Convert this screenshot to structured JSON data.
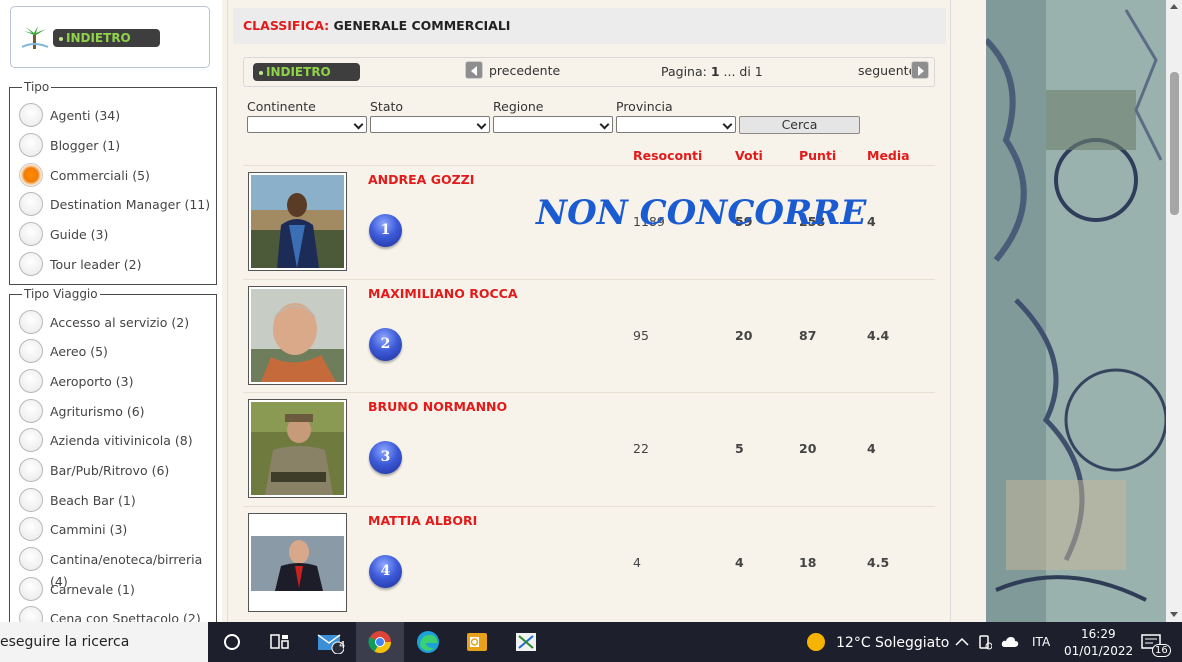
{
  "sidebar": {
    "back_button": "INDIETRO",
    "tipo": {
      "legend": "Tipo",
      "items": [
        {
          "label": "Agenti (34)",
          "checked": false
        },
        {
          "label": "Blogger (1)",
          "checked": false
        },
        {
          "label": "Commerciali (5)",
          "checked": true
        },
        {
          "label": "Destination Manager (11)",
          "checked": false
        },
        {
          "label": "Guide (3)",
          "checked": false
        },
        {
          "label": "Tour leader (2)",
          "checked": false
        }
      ]
    },
    "tipo_viaggio": {
      "legend": "Tipo Viaggio",
      "items": [
        {
          "label": "Accesso al servizio (2)"
        },
        {
          "label": "Aereo (5)"
        },
        {
          "label": "Aeroporto (3)"
        },
        {
          "label": "Agriturismo (6)"
        },
        {
          "label": "Azienda vitivinicola (8)"
        },
        {
          "label": "Bar/Pub/Ritrovo (6)"
        },
        {
          "label": "Beach Bar (1)"
        },
        {
          "label": "Cammini (3)"
        },
        {
          "label": "Cantina/enoteca/birreria"
        },
        {
          "label": "(4)"
        },
        {
          "label": "Carnevale (1)"
        },
        {
          "label": "Cena con Spettacolo (2)"
        }
      ]
    }
  },
  "main": {
    "title_prefix": "CLASSIFICA:",
    "title": "GENERALE COMMERCIALI",
    "nav": {
      "back": "INDIETRO",
      "prev": "precedente",
      "page_prefix": "Pagina:",
      "page_current": "1",
      "page_suffix": "... di 1",
      "next": "seguente"
    },
    "filters": {
      "continente": "Continente",
      "stato": "Stato",
      "regione": "Regione",
      "provincia": "Provincia",
      "search_button": "Cerca"
    },
    "columns": [
      "Resoconti",
      "Voti",
      "Punti",
      "Media"
    ],
    "stamp": "NON CONCORRE",
    "rows": [
      {
        "rank": "1",
        "name": "ANDREA GOZZI",
        "resoconti": "1189",
        "voti": "59",
        "punti": "258",
        "media": "4"
      },
      {
        "rank": "2",
        "name": "MAXIMILIANO ROCCA",
        "resoconti": "95",
        "voti": "20",
        "punti": "87",
        "media": "4.4"
      },
      {
        "rank": "3",
        "name": "BRUNO NORMANNO",
        "resoconti": "22",
        "voti": "5",
        "punti": "20",
        "media": "4"
      },
      {
        "rank": "4",
        "name": "MATTIA ALBORI",
        "resoconti": "4",
        "voti": "4",
        "punti": "18",
        "media": "4.5"
      }
    ]
  },
  "taskbar": {
    "search_text": "eseguire la ricerca",
    "mail_badge": "4",
    "weather": "12°C  Soleggiato",
    "language": "ITA",
    "time": "16:29",
    "date": "01/01/2022",
    "notifications": "16"
  },
  "colors": {
    "accent_red": "#e21a1a",
    "selected_radio": "#f07d0a",
    "rank_blue": "#2f47c6",
    "stamp_blue": "#1b5bd1"
  }
}
